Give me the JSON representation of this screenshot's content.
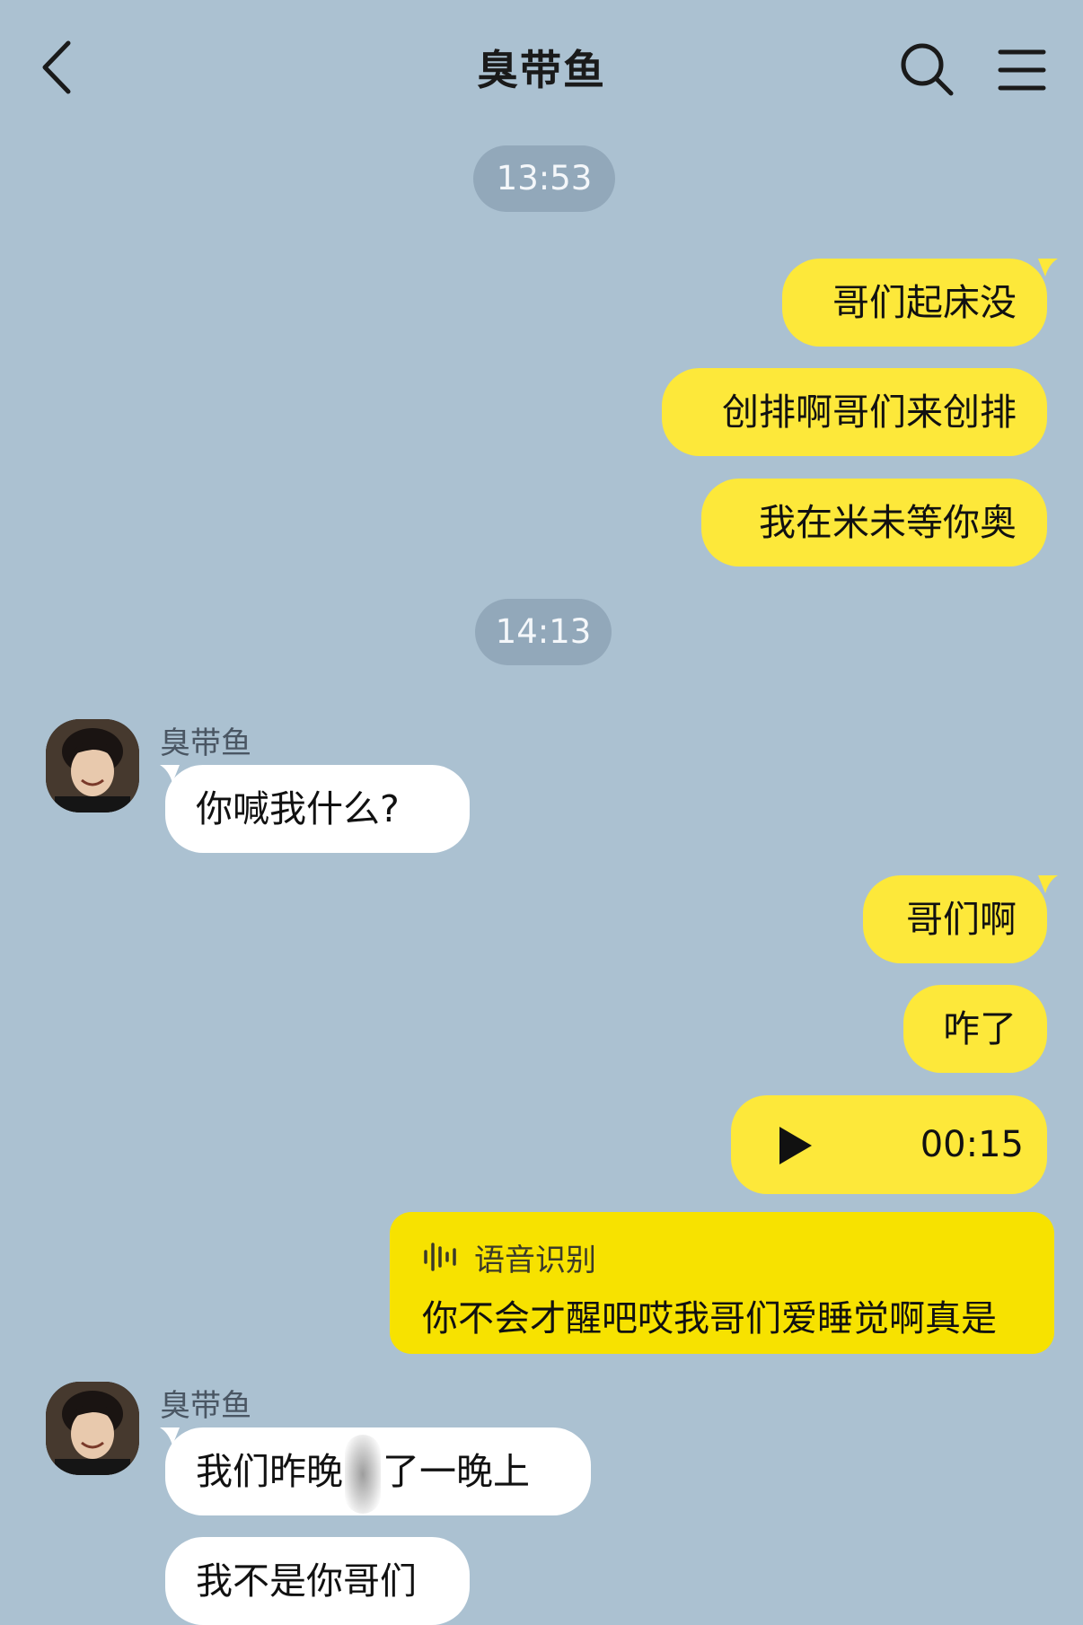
{
  "header": {
    "title": "臭带鱼",
    "back_icon": "chevron-left-icon",
    "search_icon": "search-icon",
    "menu_icon": "menu-icon"
  },
  "colors": {
    "background": "#abc1d1",
    "my_bubble": "#fde83a",
    "their_bubble": "#ffffff",
    "timestamp_bg": "#92a8ba",
    "transcript_bg": "#f7e200"
  },
  "timestamps": [
    "13:53",
    "14:13"
  ],
  "messages": {
    "m1": "哥们起床没",
    "m2": "创排啊哥们来创排",
    "m3": "我在米未等你奥",
    "m4": "你喊我什么?",
    "m5": "哥们啊",
    "m6": "咋了",
    "m8_part1": "我们昨晚",
    "m8_part2": "了一晚上",
    "m9": "我不是你哥们"
  },
  "contact": {
    "name": "臭带鱼"
  },
  "voice": {
    "duration": "00:15",
    "transcript_label": "语音识别",
    "transcript_text": "你不会才醒吧哎我哥们爱睡觉啊真是"
  }
}
